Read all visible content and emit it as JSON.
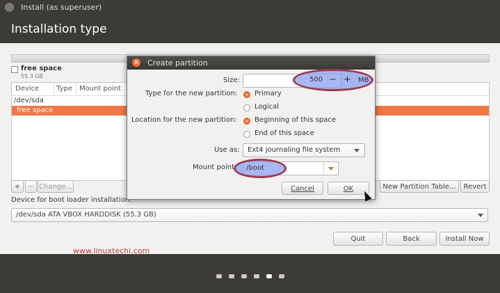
{
  "window": {
    "title": "Install (as superuser)"
  },
  "header": {
    "title": "Installation type"
  },
  "disk_legend": {
    "name": "free space",
    "size": "55.3 GB"
  },
  "table": {
    "columns": [
      "Device",
      "Type",
      "Mount point"
    ],
    "rows": [
      {
        "device": "/dev/sda"
      },
      {
        "device": "free space"
      }
    ]
  },
  "partition_buttons": {
    "add": "+",
    "remove": "−",
    "change": "Change...",
    "new_table": "New Partition Table...",
    "revert": "Revert"
  },
  "boot_loader": {
    "label": "Device for boot loader installation:",
    "selected": "/dev/sda   ATA VBOX HARDDISK (55.3 GB)"
  },
  "actions": {
    "quit": "Quit",
    "back": "Back",
    "install": "Install Now"
  },
  "watermark": "www.linuxtechi.com",
  "dialog": {
    "title": "Create partition",
    "size_label": "Size:",
    "size_value": "500",
    "size_unit": "MB",
    "minus": "−",
    "plus": "+",
    "type_label": "Type for the new partition:",
    "type_options": [
      "Primary",
      "Logical"
    ],
    "type_selected": "Primary",
    "location_label": "Location for the new partition:",
    "location_options": [
      "Beginning of this space",
      "End of this space"
    ],
    "location_selected": "Beginning of this space",
    "use_as_label": "Use as:",
    "use_as_value": "Ext4 journaling file system",
    "mount_label": "Mount point:",
    "mount_value": "/boot",
    "cancel": "Cancel",
    "ok": "OK"
  },
  "colors": {
    "accent": "#f07746",
    "highlight": "#8ca0f0",
    "highlight_border": "#9a3b4f"
  },
  "progress": {
    "steps": 6,
    "current": 4
  }
}
